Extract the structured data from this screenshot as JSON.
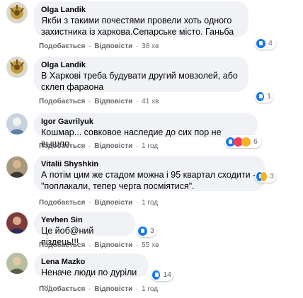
{
  "labels": {
    "like": "Подобається",
    "reply": "Відповісти",
    "sep": "·"
  },
  "comments": [
    {
      "author": "Olga Landik",
      "text": "Якби з такими почестями провели хоть одного захистника із харкова.Сепарське місто. Ганьба",
      "time": "38 хв",
      "reaction_count": "4",
      "reactions": [
        "like-icon"
      ],
      "avatar_color": "#b08a3c"
    },
    {
      "author": "Olga Landik",
      "text": "В Харкові треба будувати другий мовзолей, або склеп фараона",
      "time": "41 хв",
      "reaction_count": "1",
      "reactions": [
        "like-icon"
      ],
      "avatar_color": "#b08a3c"
    },
    {
      "author": "Igor Gavrilyuk",
      "text": "Кошмар... совковое наследие до сих пор не вышло.",
      "time": "1 год",
      "reaction_count": "6",
      "reactions": [
        "like-icon",
        "love-icon",
        "haha-icon"
      ],
      "avatar_color": "#6f8fae"
    },
    {
      "author": "Vitalii Shyshkin",
      "text": "А потім цим же стадом можна і 95 квартал сходити - \"поплакали, тепер черга посміятися\".",
      "time": "1 год",
      "reaction_count": "3",
      "reactions": [
        "like-icon",
        "haha-icon"
      ],
      "avatar_color": "#7a6a4a"
    },
    {
      "author": "Yevhen Sin",
      "text": "Це йоб@ний піздець!!!",
      "time": "55 хв",
      "reaction_count": "3",
      "reactions": [
        "like-icon"
      ],
      "avatar_color": "#5a5f9a"
    },
    {
      "author": "Lena Mazko",
      "text": "Неначе люди по дуріли ....",
      "time": "1 год",
      "reaction_count": "14",
      "reactions": [
        "like-icon"
      ],
      "avatar_color": "#8a9070"
    }
  ],
  "colors": {
    "bubble": "#f0f2f5",
    "meta": "#65676b",
    "like": "#1877f2",
    "love": "#f33e58",
    "haha": "#f7b125"
  }
}
